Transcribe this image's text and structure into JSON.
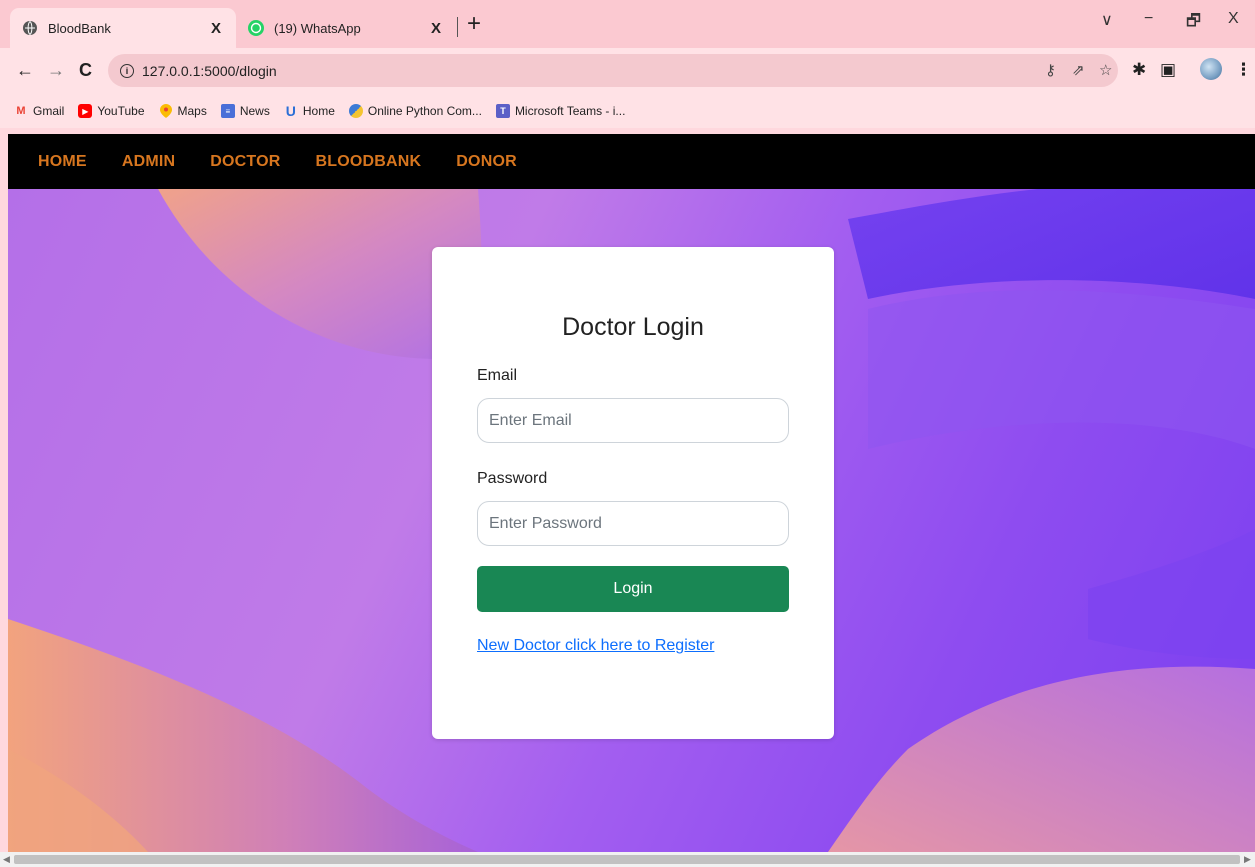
{
  "browser": {
    "tabs": [
      {
        "title": "BloodBank",
        "close": "X",
        "active": true
      },
      {
        "title": "(19) WhatsApp",
        "close": "X",
        "active": false
      }
    ],
    "new_tab": "+",
    "window_controls": {
      "dropdown": "∨",
      "minimize": "−",
      "restore": "🗗",
      "close": "X"
    },
    "url": "127.0.0.1:5000/dlogin",
    "bookmarks": [
      {
        "label": "Gmail",
        "icon": "gmail-icon"
      },
      {
        "label": "YouTube",
        "icon": "youtube-icon"
      },
      {
        "label": "Maps",
        "icon": "maps-icon"
      },
      {
        "label": "News",
        "icon": "news-icon"
      },
      {
        "label": "Home",
        "icon": "home-bookmark-icon"
      },
      {
        "label": "Online Python Com...",
        "icon": "python-icon"
      },
      {
        "label": "Microsoft Teams - i...",
        "icon": "teams-icon"
      }
    ]
  },
  "nav": {
    "items": [
      "HOME",
      "ADMIN",
      "DOCTOR",
      "BLOODBANK",
      "DONOR"
    ]
  },
  "login": {
    "title": "Doctor Login",
    "email_label": "Email",
    "email_placeholder": "Enter Email",
    "email_value": "",
    "password_label": "Password",
    "password_placeholder": "Enter Password",
    "password_value": "",
    "submit_label": "Login",
    "register_link": "New Doctor click here to Register"
  },
  "colors": {
    "nav_bg": "#000000",
    "nav_text": "#d7761f",
    "button": "#198754",
    "link": "#0d6efd",
    "browser_chrome": "#fbc9d1"
  }
}
